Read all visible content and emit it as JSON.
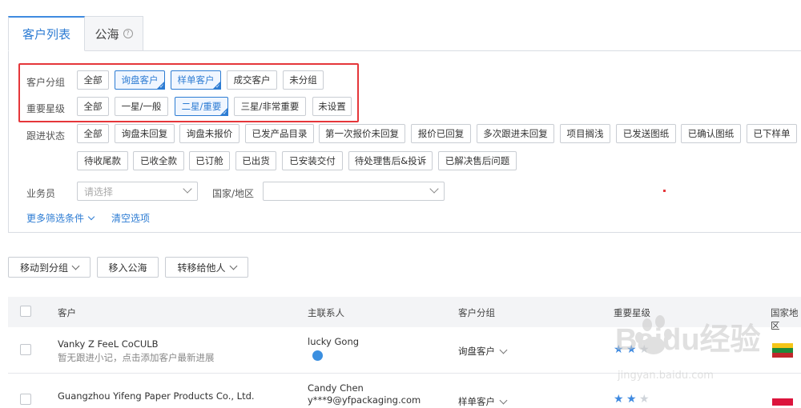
{
  "tabs": [
    {
      "label": "客户列表",
      "active": true
    },
    {
      "label": "公海",
      "active": false,
      "help_icon": "help-circle-icon"
    }
  ],
  "filters": {
    "group": {
      "label": "客户分组",
      "options": [
        {
          "label": "全部",
          "selected": false
        },
        {
          "label": "询盘客户",
          "selected": true
        },
        {
          "label": "样单客户",
          "selected": true
        },
        {
          "label": "成交客户",
          "selected": false
        },
        {
          "label": "未分组",
          "selected": false
        }
      ]
    },
    "star": {
      "label": "重要星级",
      "options": [
        {
          "label": "全部",
          "selected": false
        },
        {
          "label": "一星/一般",
          "selected": false
        },
        {
          "label": "二星/重要",
          "selected": true
        },
        {
          "label": "三星/非常重要",
          "selected": false
        },
        {
          "label": "未设置",
          "selected": false
        }
      ]
    },
    "follow": {
      "label": "跟进状态",
      "options": [
        "全部",
        "询盘未回复",
        "询盘未报价",
        "已发产品目录",
        "第一次报价未回复",
        "报价已回复",
        "多次跟进未回复",
        "项目搁浅",
        "已发送图纸",
        "已确认图纸",
        "已下样单",
        "待收尾款",
        "已收全款",
        "已订舱",
        "已出货",
        "已安装交付",
        "待处理售后&投诉",
        "已解决售后问题"
      ]
    },
    "salesperson": {
      "label": "业务员",
      "placeholder": "请选择"
    },
    "country": {
      "label": "国家/地区",
      "value": ""
    },
    "more_label": "更多筛选条件",
    "clear_label": "清空选项"
  },
  "actions": {
    "move_group": "移动到分组",
    "move_pool": "移入公海",
    "transfer": "转移给他人"
  },
  "table": {
    "columns": [
      "客户",
      "主联系人",
      "客户分组",
      "重要星级",
      "国家地区"
    ],
    "rows": [
      {
        "name": "Vanky Z FeeL CoCULB",
        "note": "暂无跟进小记，点击添加客户最新进展",
        "contact_name": "lucky Gong",
        "contact_email": "",
        "group": "询盘客户",
        "stars": 2
      },
      {
        "name": "Guangzhou Yifeng Paper Products Co., Ltd.",
        "note": "",
        "contact_name": "Candy Chen",
        "contact_email": "y***9@yfpackaging.com",
        "group": "样单客户",
        "stars": 2
      }
    ]
  },
  "colors": {
    "accent": "#2d7cd3",
    "highlight_box": "#e5363a",
    "star_filled": "#3f8ae0",
    "star_empty": "#cfd4da"
  },
  "watermark": {
    "brand": "Baidu经验",
    "url": "jingyan.baidu.com"
  }
}
